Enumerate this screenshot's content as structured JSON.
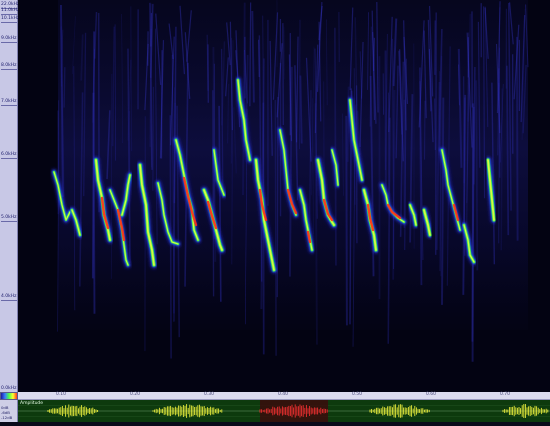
{
  "frequency_axis": {
    "ticks": [
      "22.0kHz",
      "11.0kHz",
      "10.1kHz",
      "9.0kHz",
      "8.0kHz",
      "7.0kHz",
      "6.0kHz",
      "5.0kHz",
      "4.0kHz",
      "0.0kHz"
    ]
  },
  "time_ruler": {
    "ticks": [
      "0.10",
      "0.20",
      "0.30",
      "0.40",
      "0.50",
      "0.60",
      "0.70"
    ]
  },
  "amplitude_panel": {
    "title": "Amplitude",
    "labels": [
      "0dB",
      "-6dB",
      "-12dB"
    ]
  },
  "colors": {
    "background": "#030312",
    "low": "#2a2ad0",
    "mid": "#3cff3c",
    "high": "#ffff40",
    "peak": "#ff2a1a",
    "selection": "#ff3333"
  }
}
